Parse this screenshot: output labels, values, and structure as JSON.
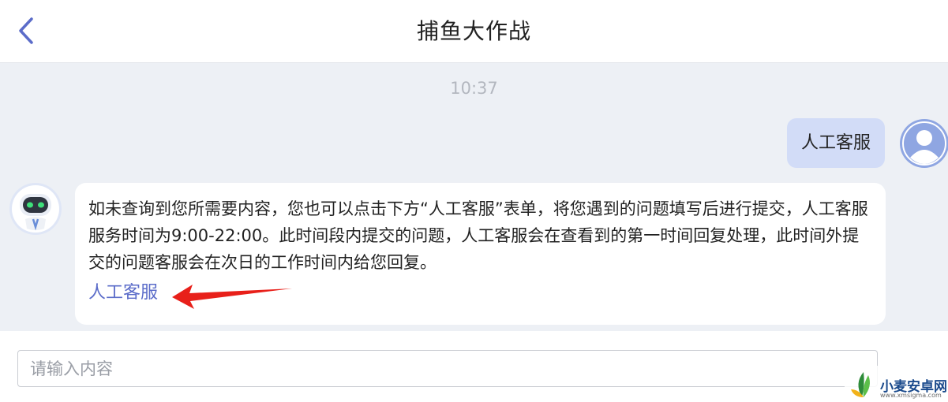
{
  "header": {
    "title": "捕鱼大作战",
    "back_icon": "chevron-left-icon"
  },
  "chat": {
    "timestamp": "10:37",
    "user_message": "人工客服",
    "bot_message": "如未查询到您所需要内容，您也可以点击下方“人工客服”表单，将您遇到的问题填写后进行提交，人工客服服务时间为9:00-22:00。此时间段内提交的问题，人工客服会在查看到的第一时间回复处理，此时间外提交的问题客服会在次日的工作时间内给您回复。",
    "bot_link": "人工客服"
  },
  "input": {
    "placeholder": "请输入内容"
  },
  "watermark": {
    "name": "小麦安卓网",
    "url": "www.xmsigma.com"
  },
  "colors": {
    "accent": "#5b6cc9",
    "user_bubble": "#d2dcf7",
    "background": "#edf0f5",
    "arrow": "#e8201a"
  }
}
